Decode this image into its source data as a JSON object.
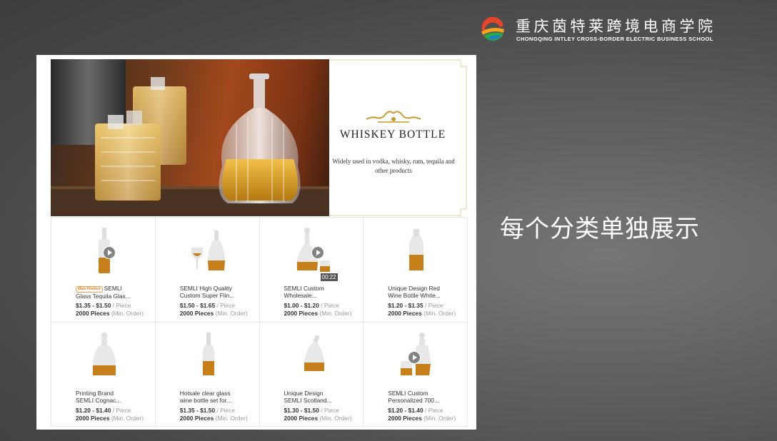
{
  "header": {
    "school_name_cn": "重庆茵特莱跨境电商学院",
    "school_name_en": "CHONGQING INTLEY CROSS-BORDER ELECTRIC BUSINESS SCHOOL"
  },
  "caption": "每个分类单独展示",
  "banner": {
    "title": "WHISKEY BOTTLE",
    "description": "Widely used in vodka, whisky, rum, tequila and other products"
  },
  "products": [
    {
      "badge": "Main Product",
      "name": "SEMLI Glass Tequila Glas...",
      "price": "$1.35 - $1.50",
      "unit": "/ Piece",
      "moq": "2000 Pieces",
      "moq_note": "(Min. Order)",
      "video": true,
      "duration": ""
    },
    {
      "badge": "",
      "name": "SEMLI High Quality Custom Super Flin...",
      "price": "$1.50 - $1.65",
      "unit": "/ Piece",
      "moq": "2000 Pieces",
      "moq_note": "(Min. Order)",
      "video": false,
      "duration": ""
    },
    {
      "badge": "",
      "name": "SEMLI Custom Wholesale...",
      "price": "$1.00 - $1.20",
      "unit": "/ Piece",
      "moq": "2000 Pieces",
      "moq_note": "(Min. Order)",
      "video": true,
      "duration": "00:22"
    },
    {
      "badge": "",
      "name": "Unique Design Red Wine Bottle White...",
      "price": "$1.20 - $1.35",
      "unit": "/ Piece",
      "moq": "2000 Pieces",
      "moq_note": "(Min. Order)",
      "video": false,
      "duration": ""
    },
    {
      "badge": "",
      "name": "Printing Brand SEMLI Cognac...",
      "price": "$1.20 - $1.40",
      "unit": "/ Piece",
      "moq": "2000 Pieces",
      "moq_note": "(Min. Order)",
      "video": false,
      "duration": ""
    },
    {
      "badge": "",
      "name": "Hotsale clear glass wine bottle set for...",
      "price": "$1.35 - $1.50",
      "unit": "/ Piece",
      "moq": "2000 Pieces",
      "moq_note": "(Min. Order)",
      "video": false,
      "duration": ""
    },
    {
      "badge": "",
      "name": "Unique Design SEMLI Scotland...",
      "price": "$1.30 - $1.50",
      "unit": "/ Piece",
      "moq": "2000 Pieces",
      "moq_note": "(Min. Order)",
      "video": false,
      "duration": ""
    },
    {
      "badge": "",
      "name": "SEMLI Custom Personalized 700...",
      "price": "$1.20 - $1.40",
      "unit": "/ Piece",
      "moq": "2000 Pieces",
      "moq_note": "(Min. Order)",
      "video": true,
      "duration": ""
    }
  ]
}
